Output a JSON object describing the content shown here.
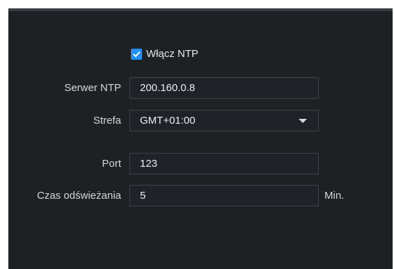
{
  "ntp": {
    "enable_label": "Włącz NTP",
    "enabled": true
  },
  "fields": {
    "server": {
      "label": "Serwer NTP",
      "value": "200.160.0.8"
    },
    "zone": {
      "label": "Strefa",
      "value": "GMT+01:00"
    },
    "port": {
      "label": "Port",
      "value": "123"
    },
    "refresh": {
      "label": "Czas odświeżania",
      "value": "5",
      "unit": "Min."
    }
  },
  "colors": {
    "panel_bg": "#1e2124",
    "accent": "#1e90ff"
  },
  "icons": {
    "checkbox": "checkmark-icon",
    "dropdown": "chevron-down-icon"
  }
}
